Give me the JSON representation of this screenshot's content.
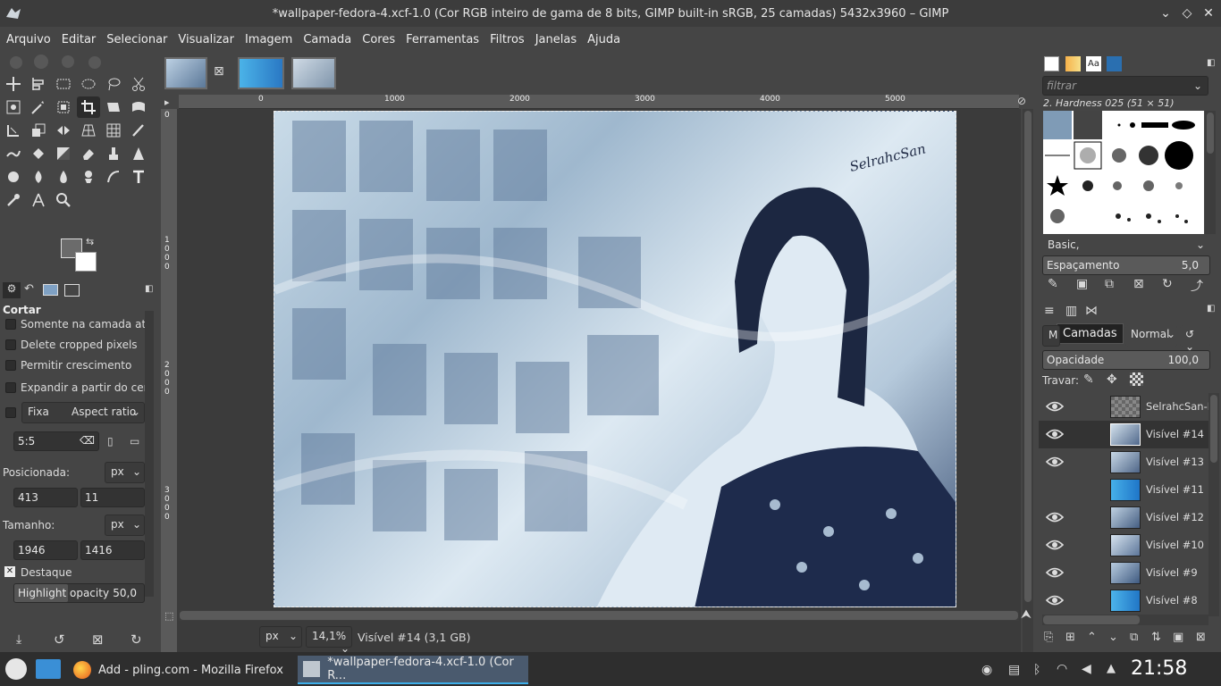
{
  "window": {
    "title": "*wallpaper-fedora-4.xcf-1.0 (Cor RGB inteiro de gama de 8 bits, GIMP built-in sRGB, 25 camadas) 5432x3960 – GIMP"
  },
  "menu": [
    "Arquivo",
    "Editar",
    "Selecionar",
    "Visualizar",
    "Imagem",
    "Camada",
    "Cores",
    "Ferramentas",
    "Filtros",
    "Janelas",
    "Ajuda"
  ],
  "tool_options": {
    "title": "Cortar",
    "options": [
      "Somente na camada atual",
      "Delete cropped pixels",
      "Permitir crescimento",
      "Expandir a partir do centro"
    ],
    "fixed_label": "Fixa",
    "fixed_mode": "Aspect ratio",
    "ratio_value": "5:5",
    "position_label": "Posicionada:",
    "position_unit": "px",
    "pos_x": "413",
    "pos_y": "11",
    "size_label": "Tamanho:",
    "size_unit": "px",
    "size_w": "1946",
    "size_h": "1416",
    "highlight_label": "Destaque",
    "highlight_opacity_label": "Highlight opacity",
    "highlight_opacity_value": "50,0"
  },
  "rulers": {
    "h_ticks": [
      "0",
      "1000",
      "2000",
      "3000",
      "4000",
      "5000"
    ],
    "v_ticks": [
      "0",
      "1000",
      "2000",
      "3000"
    ]
  },
  "image_overlay_text": "SelrahcSan",
  "status": {
    "unit": "px",
    "zoom": "14,1%",
    "layer_info": "Visível #14 (3,1 GB)"
  },
  "brushes": {
    "filter_placeholder": "filtrar",
    "selected": "2. Hardness 025 (51 × 51)",
    "preset": "Basic,",
    "spacing_label": "Espaçamento",
    "spacing_value": "5,0"
  },
  "layers": {
    "tooltip": "Camadas",
    "mode": "Normal",
    "opacity_label": "Opacidade",
    "opacity_value": "100,0",
    "lock_label": "Travar:",
    "items": [
      {
        "name": "SelrahcSan-M",
        "visible": true
      },
      {
        "name": "Visível #14",
        "visible": true
      },
      {
        "name": "Visível #13",
        "visible": true
      },
      {
        "name": "Visível #11",
        "visible": false
      },
      {
        "name": "Visível #12",
        "visible": true
      },
      {
        "name": "Visível #10",
        "visible": true
      },
      {
        "name": "Visível #9",
        "visible": true
      },
      {
        "name": "Visível #8",
        "visible": true
      }
    ]
  },
  "taskbar": {
    "firefox": "Add - pling.com - Mozilla Firefox",
    "gimp": "*wallpaper-fedora-4.xcf-1.0 (Cor R...",
    "clock": "21:58"
  }
}
